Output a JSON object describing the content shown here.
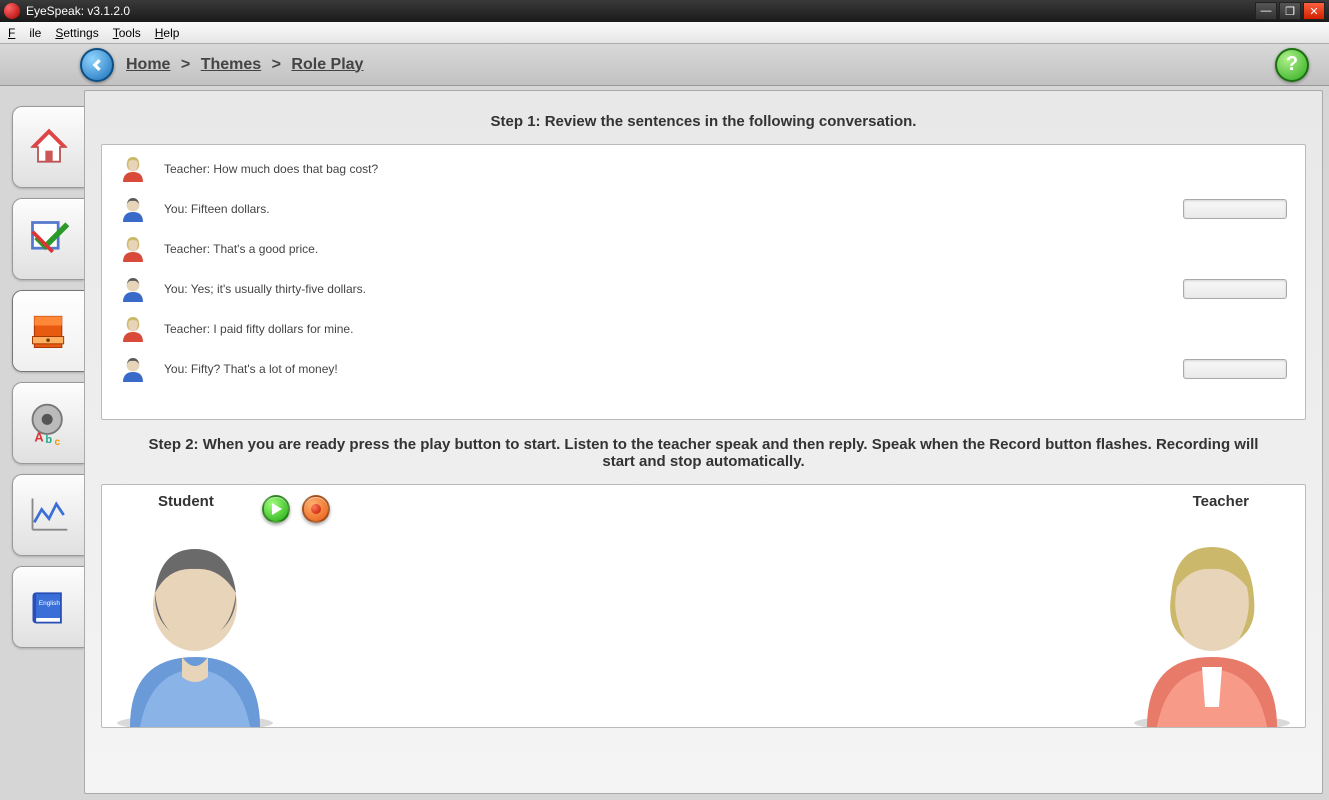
{
  "window": {
    "title": "EyeSpeak:  v3.1.2.0"
  },
  "menu": {
    "file": "File",
    "settings": "Settings",
    "tools": "Tools",
    "help": "Help"
  },
  "breadcrumb": {
    "home": "Home",
    "themes": "Themes",
    "roleplay": "Role Play",
    "sep": ">"
  },
  "sidebar": {
    "items": [
      {
        "name": "home-icon"
      },
      {
        "name": "check-icon"
      },
      {
        "name": "drawer-icon"
      },
      {
        "name": "pronounce-icon"
      },
      {
        "name": "chart-icon"
      },
      {
        "name": "dictionary-icon"
      }
    ]
  },
  "step1": {
    "title": "Step 1: Review the sentences in the following conversation.",
    "lines": [
      {
        "speaker": "teacher",
        "text": "Teacher: How much does that bag cost?",
        "hasProgress": false
      },
      {
        "speaker": "you",
        "text": "You: Fifteen dollars.",
        "hasProgress": true
      },
      {
        "speaker": "teacher",
        "text": "Teacher: That's a good price.",
        "hasProgress": false
      },
      {
        "speaker": "you",
        "text": "You: Yes; it's usually thirty-five dollars.",
        "hasProgress": true
      },
      {
        "speaker": "teacher",
        "text": "Teacher: I paid fifty dollars for mine.",
        "hasProgress": false
      },
      {
        "speaker": "you",
        "text": "You: Fifty? That's a lot of money!",
        "hasProgress": true
      }
    ]
  },
  "step2": {
    "title": "Step 2: When you are ready press the play button to start. Listen to the teacher speak and then reply. Speak when the Record button flashes. Recording will start and stop automatically.",
    "studentLabel": "Student",
    "teacherLabel": "Teacher"
  }
}
